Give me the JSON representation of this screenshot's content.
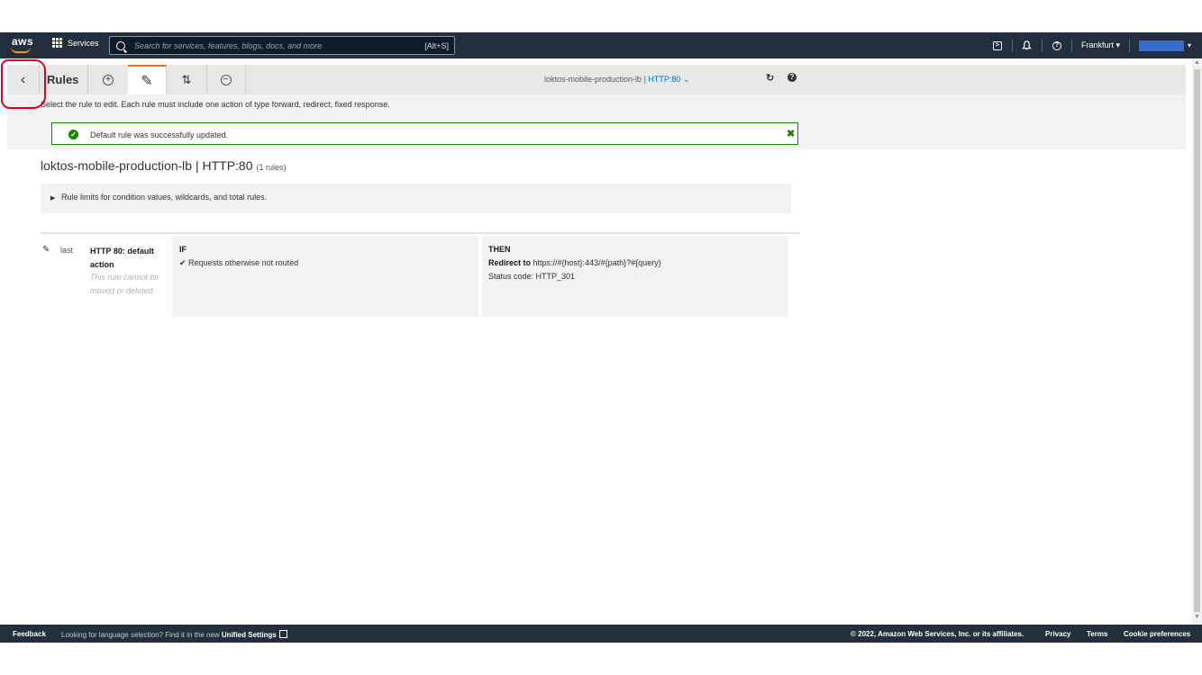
{
  "topnav": {
    "logo": "aws",
    "services_label": "Services",
    "search_placeholder": "Search for services, features, blogs, docs, and more",
    "search_shortcut": "[Alt+S]",
    "region": "Frankfurt ▾",
    "account_caret": "▾"
  },
  "toolbar": {
    "back_icon": "‹",
    "title": "Rules",
    "add_icon": "+",
    "edit_icon": "✎",
    "reorder_icon": "⇅",
    "delete_icon": "−",
    "lb_name": "loktos-mobile-production-lb",
    "lb_sep": " | ",
    "listener": "HTTP:80 ⌄",
    "refresh_icon": "↻",
    "help_icon": "?"
  },
  "notice": {
    "instructions": "Select the rule to edit. Each rule must include one action of type forward, redirect, fixed response.",
    "success_message": "Default rule was successfully updated.",
    "success_icon": "✓",
    "close_icon": "✖"
  },
  "listener_heading": {
    "title": "loktos-mobile-production-lb | HTTP:80",
    "count": "(1 rules)"
  },
  "limits": {
    "caret": "▶",
    "text": "Rule limits for condition values, wildcards, and total rules."
  },
  "rule": {
    "edit_icon": "✎",
    "priority": "last",
    "name": "HTTP 80: default action",
    "note": "This rule cannot be moved or deleted",
    "if_label": "IF",
    "if_condition": "✔ Requests otherwise not routed",
    "then_label": "THEN",
    "then_redirect_label": "Redirect to",
    "then_redirect_value": " https://#{host}:443/#{path}?#{query}",
    "then_status": "Status code: HTTP_301"
  },
  "footer": {
    "feedback": "Feedback",
    "lang_note": "Looking for language selection? Find it in the new ",
    "lang_link": "Unified Settings",
    "copyright": "© 2022, Amazon Web Services, Inc. or its affiliates.",
    "privacy": "Privacy",
    "terms": "Terms",
    "cookies": "Cookie preferences"
  },
  "colors": {
    "nav_bg": "#232f3e",
    "accent": "#ec7211",
    "success": "#1d8102",
    "link": "#0073bb",
    "annotation": "#e1001a"
  }
}
